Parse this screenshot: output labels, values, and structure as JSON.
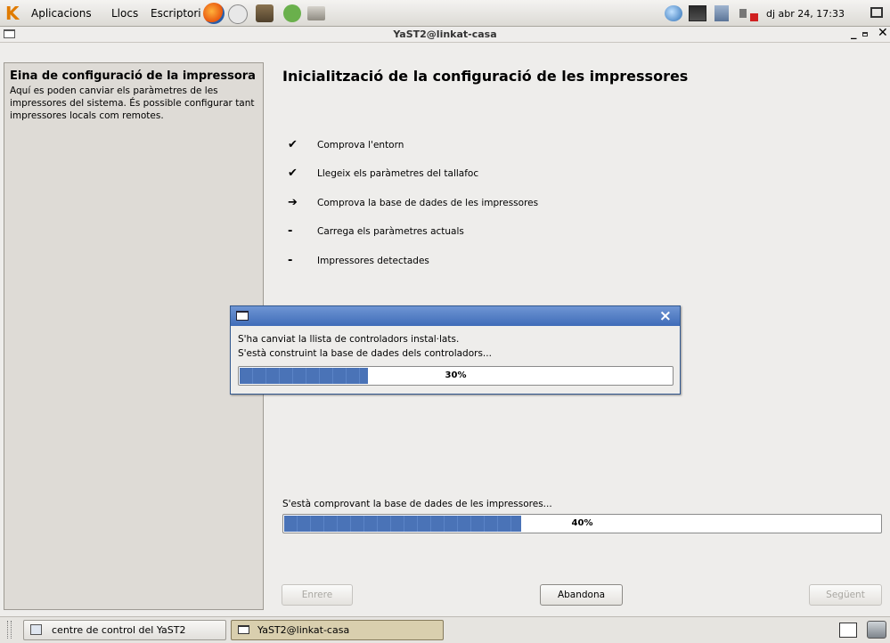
{
  "top_panel": {
    "menus": [
      "Aplicacions",
      "Llocs",
      "Escriptori"
    ],
    "clock": "dj abr 24, 17:33"
  },
  "window": {
    "title": "YaST2@linkat-casa"
  },
  "help": {
    "title": "Eina de configuració de la impressora",
    "text": "Aquí es poden canviar els paràmetres de les impressores del sistema. És possible configurar tant impressores locals com remotes."
  },
  "main": {
    "title": "Inicialització de la configuració de les impressores",
    "steps": [
      {
        "mark": "✔",
        "label": "Comprova l'entorn"
      },
      {
        "mark": "✔",
        "label": "Llegeix els paràmetres del tallafoc"
      },
      {
        "mark": "➔",
        "label": "Comprova la base de dades de les impressores"
      },
      {
        "mark": "-",
        "label": "Carrega els paràmetres actuals"
      },
      {
        "mark": "-",
        "label": "Impressores detectades"
      }
    ],
    "status": "S'està comprovant la base de dades de les impressores...",
    "progress": {
      "value": 40,
      "label": "40%"
    }
  },
  "dialog": {
    "line1": "S'ha canviat la llista de controladors instal·lats.",
    "line2": "S'està construint la base de dades dels controladors...",
    "progress": {
      "value": 30,
      "label": "30%"
    },
    "close": "×"
  },
  "buttons": {
    "back": "Enrere",
    "abort": "Abandona",
    "next": "Següent"
  },
  "taskbar": {
    "tasks": [
      "centre de control del YaST2",
      "YaST2@linkat-casa"
    ]
  },
  "colors": {
    "progress_fill": "#4a73b7",
    "dialog_titlebar": "#5580c6"
  }
}
